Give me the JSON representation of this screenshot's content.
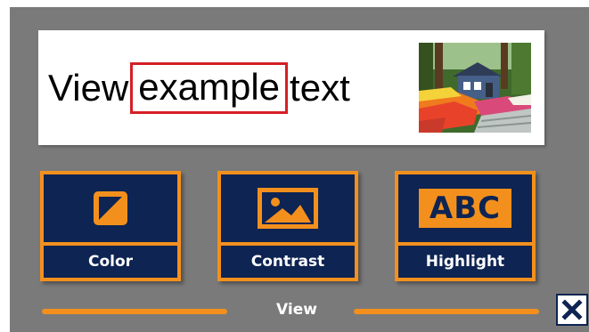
{
  "preview": {
    "text_before": "View",
    "text_highlighted": "example",
    "text_after": "text",
    "highlight_color": "#d41f26",
    "photo_icon": "garden-house-photo"
  },
  "tiles": [
    {
      "label": "Color",
      "icon": "color-square-icon"
    },
    {
      "label": "Contrast",
      "icon": "image-icon"
    },
    {
      "label": "Highlight",
      "icon_text": "ABC"
    }
  ],
  "footer": {
    "label": "View",
    "close_icon": "close-icon"
  },
  "colors": {
    "background": "#7a7a7a",
    "tile_fill": "#0e2452",
    "accent": "#f3901d",
    "panel": "#ffffff"
  }
}
